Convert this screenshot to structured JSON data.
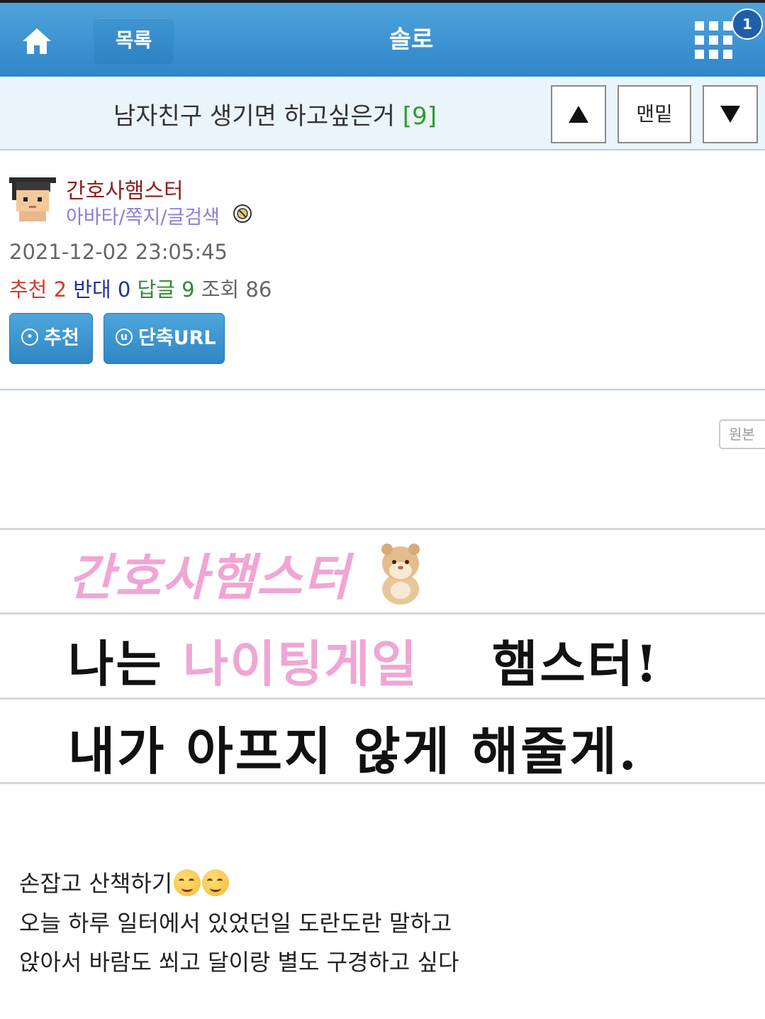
{
  "topbar": {
    "list_label": "목록",
    "site_title": "솔로",
    "notification_count": "1",
    "home_icon": "home-icon",
    "menu_icon": "grid-menu-icon"
  },
  "post": {
    "title": "남자친구 생기면 하고싶은거",
    "comment_count": "[9]",
    "nav_bottom_label": "맨밑",
    "author": "간호사햄스터",
    "author_links": "아바타/쪽지/글검색",
    "date": "2021-12-02 23:05:45",
    "stats": {
      "recommend_label": "추천",
      "recommend_value": "2",
      "oppose_label": "반대",
      "oppose_value": "0",
      "reply_label": "답글",
      "reply_value": "9",
      "views_label": "조회",
      "views_value": "86"
    },
    "buttons": {
      "recommend": "추천",
      "short_url": "단축URL",
      "original": "원본"
    },
    "image_text": {
      "line1": "간호사햄스터",
      "line2_a": "나는",
      "line2_b": "나이팅게일",
      "line2_c": "햄스터!",
      "line3": "내가 아프지 않게 해줄게."
    },
    "body_lines": [
      "손잡고 산책하기",
      "오늘 하루 일터에서 있었던일 도란도란 말하고",
      "앉아서 바람도 쐬고 달이랑 별도 구경하고 싶다"
    ]
  },
  "colors": {
    "header_blue": "#2f86c8",
    "author_name": "#8b1f1f",
    "author_links": "#8a7fd6",
    "recommend_red": "#d63a2a",
    "oppose_blue": "#1f2fa0",
    "reply_green": "#2e8b2e",
    "handwriting_pink": "#f0a6d4"
  }
}
